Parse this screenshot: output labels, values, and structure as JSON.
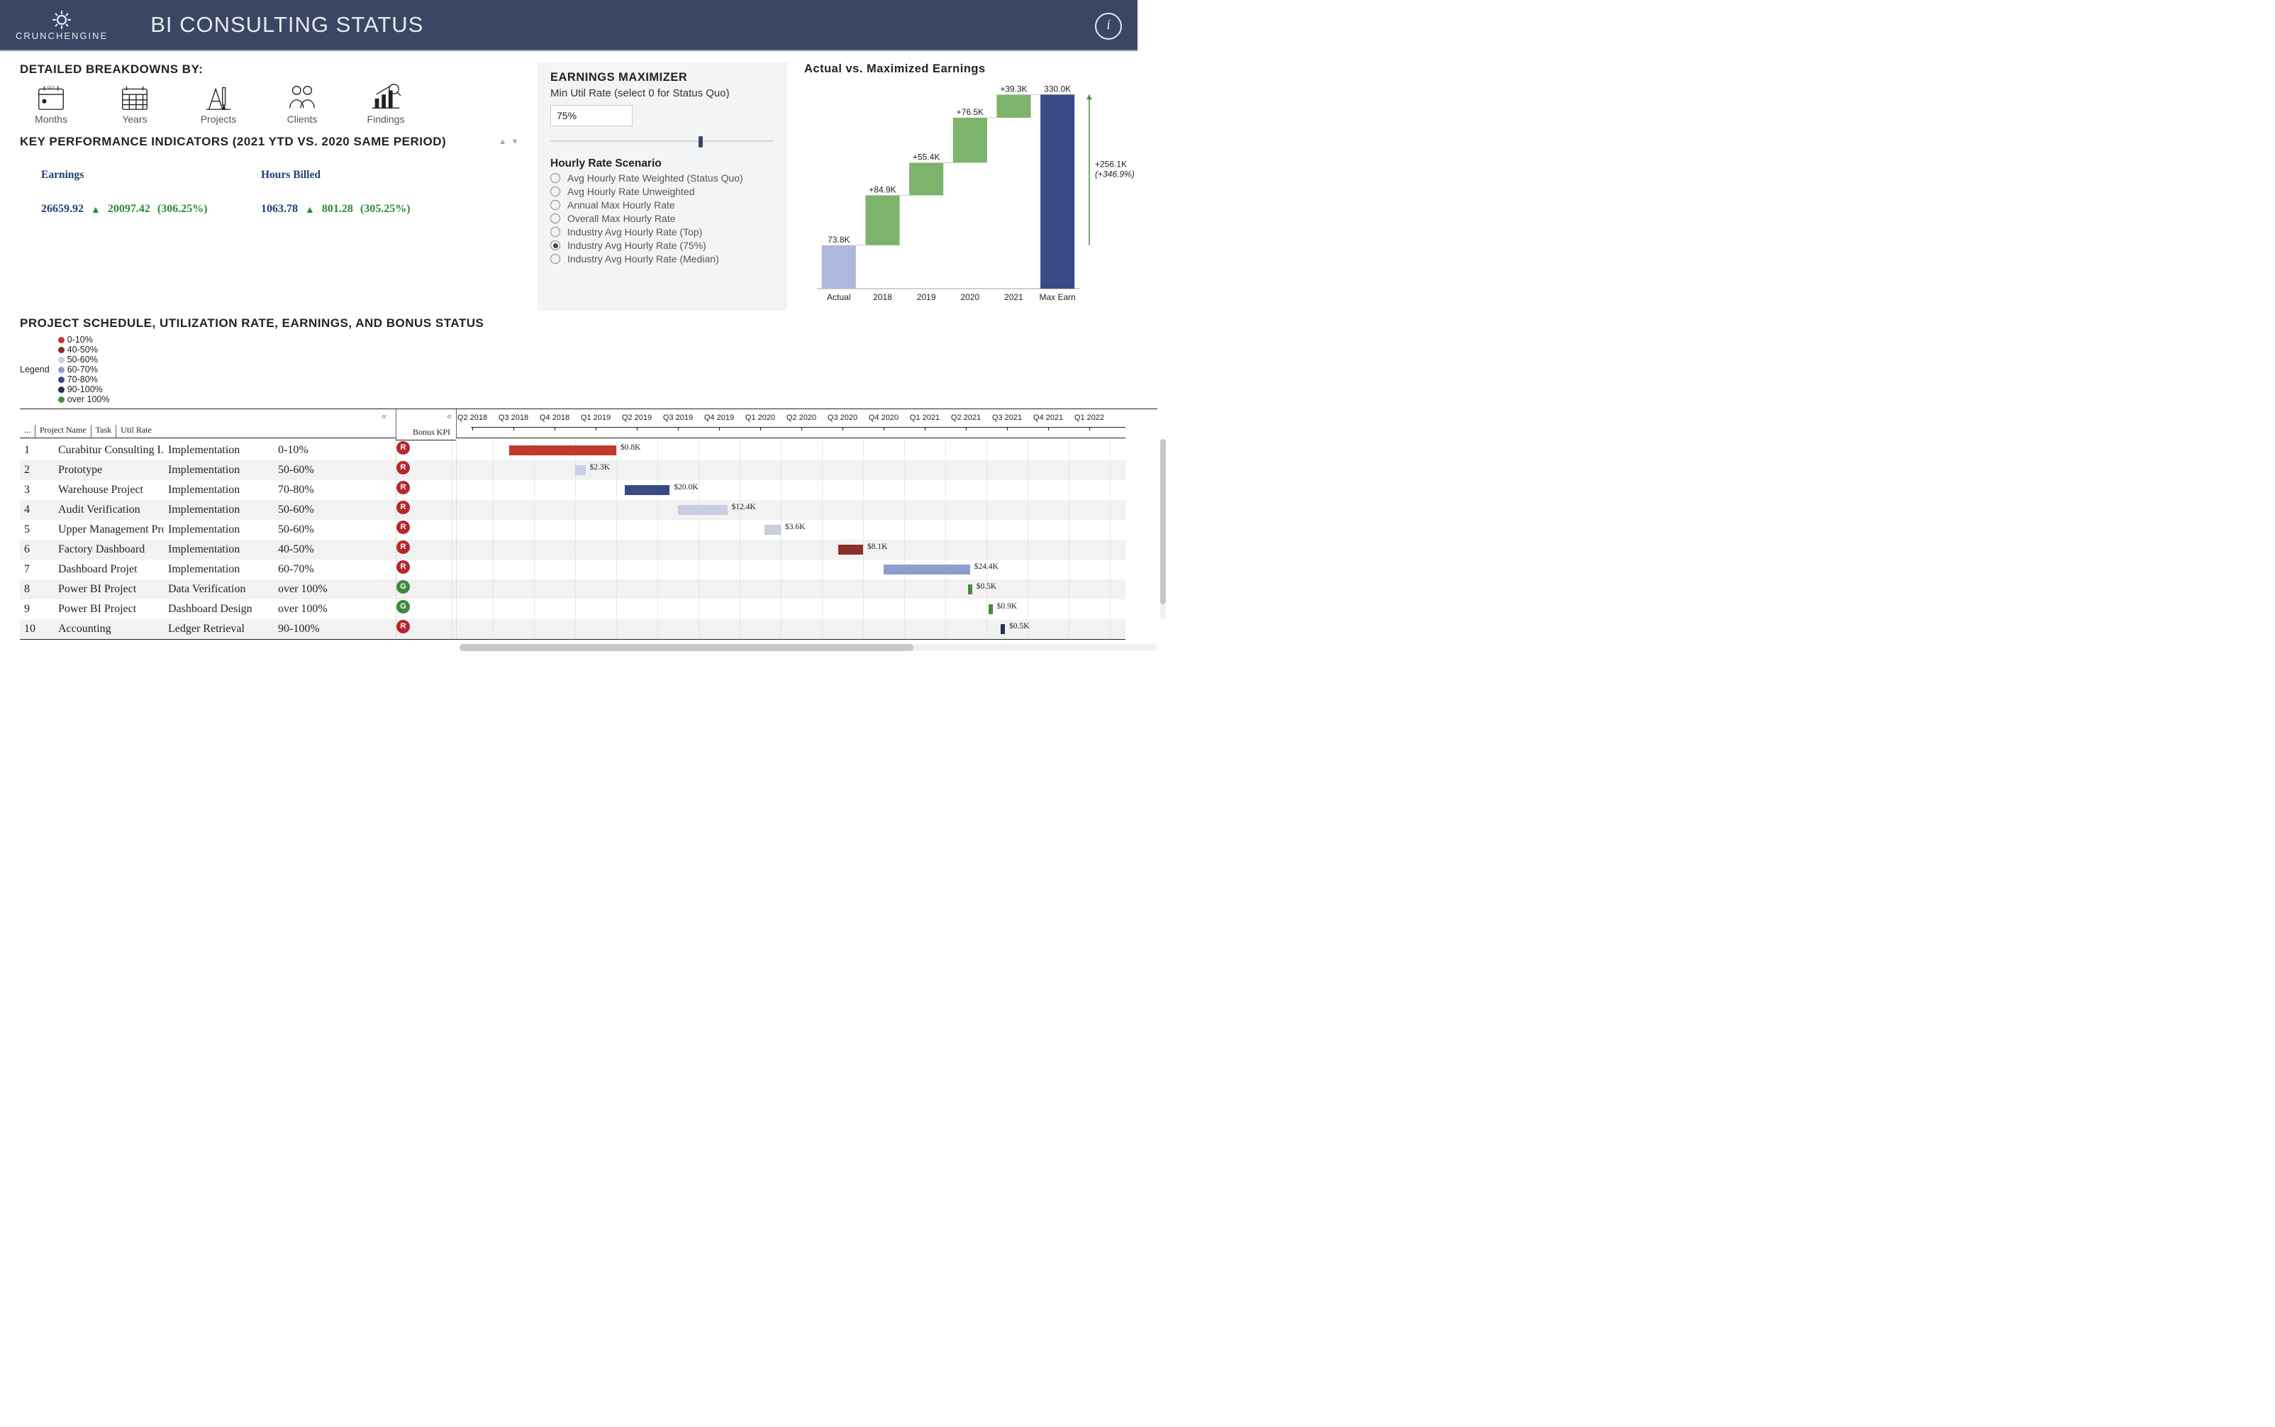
{
  "header": {
    "brand_top": "CRUNCH",
    "brand_bottom": "ENGINE",
    "title": "BI CONSULTING STATUS",
    "info_icon": "info-icon"
  },
  "breakdowns": {
    "title": "DETAILED BREAKDOWNS BY:",
    "items": [
      {
        "label": "Months",
        "icon": "calendar-month-icon"
      },
      {
        "label": "Years",
        "icon": "calendar-year-icon"
      },
      {
        "label": "Projects",
        "icon": "drafting-icon"
      },
      {
        "label": "Clients",
        "icon": "people-icon"
      },
      {
        "label": "Findings",
        "icon": "chart-search-icon"
      }
    ]
  },
  "kpi": {
    "title": "KEY PERFORMANCE INDICATORS (2021 YTD VS. 2020 SAME PERIOD)",
    "metrics": [
      {
        "name": "Earnings",
        "current": "26659.92",
        "direction": "up",
        "prev": "20097.42",
        "pct": "(306.25%)"
      },
      {
        "name": "Hours Billed",
        "current": "1063.78",
        "direction": "up",
        "prev": "801.28",
        "pct": "(305.25%)"
      }
    ]
  },
  "maximizer": {
    "title": "EARNINGS MAXIMIZER",
    "util_label": "Min Util Rate (select 0 for Status Quo)",
    "util_value": "75%",
    "slider_pct": 66,
    "scenario_title": "Hourly Rate Scenario",
    "scenarios": [
      {
        "label": "Avg Hourly Rate Weighted (Status Quo)",
        "selected": false
      },
      {
        "label": "Avg Hourly Rate Unweighted",
        "selected": false
      },
      {
        "label": "Annual Max Hourly Rate",
        "selected": false
      },
      {
        "label": "Overall Max Hourly Rate",
        "selected": false
      },
      {
        "label": "Industry Avg Hourly Rate (Top)",
        "selected": false
      },
      {
        "label": "Industry Avg Hourly Rate (75%)",
        "selected": true
      },
      {
        "label": "Industry Avg Hourly Rate (Median)",
        "selected": false
      }
    ]
  },
  "waterfall": {
    "title": "Actual vs. Maximized Earnings",
    "total_delta": "+256.1K",
    "total_pct": "(+346.9%)"
  },
  "chart_data": {
    "type": "waterfall",
    "title": "Actual vs. Maximized Earnings",
    "categories": [
      "Actual",
      "2018",
      "2019",
      "2020",
      "2021",
      "Max Earn"
    ],
    "series": [
      {
        "name": "Value (K)",
        "values": [
          73.8,
          84.9,
          55.4,
          76.5,
          39.3,
          330.0
        ]
      },
      {
        "name": "Step type",
        "values": [
          "start",
          "delta",
          "delta",
          "delta",
          "delta",
          "end"
        ]
      }
    ],
    "value_labels": [
      "73.8K",
      "+84.9K",
      "+55.4K",
      "+76.5K",
      "+39.3K",
      "330.0K"
    ],
    "colors": {
      "start": "#aeb8dc",
      "delta": "#7eb36c",
      "end": "#3a4a86"
    },
    "ylim": [
      0,
      340
    ],
    "annotations": [
      {
        "text": "+256.1K (+346.9%)",
        "side": "right"
      }
    ]
  },
  "gantt": {
    "title": "PROJECT SCHEDULE, UTILIZATION RATE, EARNINGS, AND BONUS STATUS",
    "legend_label": "Legend",
    "legend": [
      {
        "label": "0-10%",
        "class": "c-0"
      },
      {
        "label": "40-50%",
        "class": "c-40"
      },
      {
        "label": "50-60%",
        "class": "c-50"
      },
      {
        "label": "60-70%",
        "class": "c-60"
      },
      {
        "label": "70-80%",
        "class": "c-70"
      },
      {
        "label": "90-100%",
        "class": "c-90"
      },
      {
        "label": "over 100%",
        "class": "c-100"
      }
    ],
    "columns": {
      "idx": "...",
      "name": "Project Name",
      "task": "Task",
      "util": "Util Rate",
      "bonus": "Bonus KPI"
    },
    "quarters": [
      "Q2 2018",
      "Q3 2018",
      "Q4 2018",
      "Q1 2019",
      "Q2 2019",
      "Q3 2019",
      "Q4 2019",
      "Q1 2020",
      "Q2 2020",
      "Q3 2020",
      "Q4 2020",
      "Q1 2021",
      "Q2 2021",
      "Q3 2021",
      "Q4 2021",
      "Q1 2022"
    ],
    "qwidth": 58,
    "qstart": 22,
    "rows": [
      {
        "idx": "1",
        "name": "Curabitur Consulting I...",
        "task": "Implementation",
        "util": "0-10%",
        "cls": "c-0",
        "bonus": "R",
        "bar_q": [
          1.4,
          4.0
        ],
        "val": "$0.8K"
      },
      {
        "idx": "2",
        "name": "Prototype",
        "task": "Implementation",
        "util": "50-60%",
        "cls": "c-50",
        "bonus": "R",
        "bar_q": [
          3.0,
          3.25
        ],
        "val": "$2.3K"
      },
      {
        "idx": "3",
        "name": "Warehouse Project",
        "task": "Implementation",
        "util": "70-80%",
        "cls": "c-70",
        "bonus": "R",
        "bar_q": [
          4.2,
          5.3
        ],
        "val": "$20.0K"
      },
      {
        "idx": "4",
        "name": "Audit Verification",
        "task": "Implementation",
        "util": "50-60%",
        "cls": "c-50",
        "bonus": "R",
        "bar_q": [
          5.5,
          6.7
        ],
        "val": "$12.4K"
      },
      {
        "idx": "5",
        "name": "Upper Management Pro...",
        "task": "Implementation",
        "util": "50-60%",
        "cls": "c-50",
        "bonus": "R",
        "bar_q": [
          7.6,
          8.0
        ],
        "val": "$3.6K"
      },
      {
        "idx": "6",
        "name": "Factory Dashboard",
        "task": "Implementation",
        "util": "40-50%",
        "cls": "c-40",
        "bonus": "R",
        "bar_q": [
          9.4,
          10.0
        ],
        "val": "$8.1K"
      },
      {
        "idx": "7",
        "name": "Dashboard Projet",
        "task": "Implementation",
        "util": "60-70%",
        "cls": "c-60",
        "bonus": "R",
        "bar_q": [
          10.5,
          12.6
        ],
        "val": "$24.4K"
      },
      {
        "idx": "8",
        "name": "Power BI Project",
        "task": "Data Verification",
        "util": "over 100%",
        "cls": "c-100",
        "bonus": "G",
        "bar_q": [
          12.55,
          12.65
        ],
        "val": "$0.5K"
      },
      {
        "idx": "9",
        "name": "Power BI Project",
        "task": "Dashboard Design",
        "util": "over 100%",
        "cls": "c-100",
        "bonus": "G",
        "bar_q": [
          13.05,
          13.15
        ],
        "val": "$0.9K"
      },
      {
        "idx": "10",
        "name": "Accounting",
        "task": "Ledger Retrieval",
        "util": "90-100%",
        "cls": "c-90",
        "bonus": "R",
        "bar_q": [
          13.35,
          13.45
        ],
        "val": "$0.5K"
      }
    ]
  }
}
